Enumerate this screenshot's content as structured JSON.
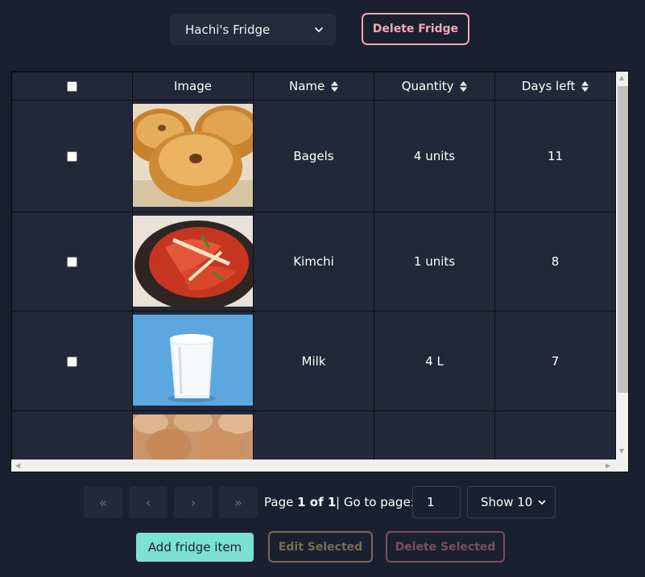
{
  "fridge_selector": {
    "value": "Hachi's Fridge",
    "icon": "chevron-down-icon"
  },
  "delete_fridge_label": "Delete Fridge",
  "table": {
    "columns": [
      "",
      "Image",
      "Name",
      "Quantity",
      "Days left"
    ],
    "rows": [
      {
        "image": "bagels-photo",
        "name": "Bagels",
        "quantity": "4 units",
        "days_left": "11"
      },
      {
        "image": "kimchi-photo",
        "name": "Kimchi",
        "quantity": "1 units",
        "days_left": "8"
      },
      {
        "image": "milk-photo",
        "name": "Milk",
        "quantity": "4 L",
        "days_left": "7"
      },
      {
        "image": "eggs-photo",
        "name": "",
        "quantity": "",
        "days_left": ""
      }
    ]
  },
  "pagination": {
    "first": "«",
    "prev": "‹",
    "next": "›",
    "last": "»",
    "page_prefix": "Page",
    "page_current": "1 of 1",
    "goto_label": "| Go to page:",
    "goto_value": "1",
    "show_value": "Show 10"
  },
  "buttons": {
    "add": "Add fridge item",
    "edit": "Edit Selected",
    "delete": "Delete Selected"
  },
  "colors": {
    "background": "#1b2030",
    "accent_teal": "#7ce0d3",
    "delete_pink": "#f4a9b6"
  }
}
